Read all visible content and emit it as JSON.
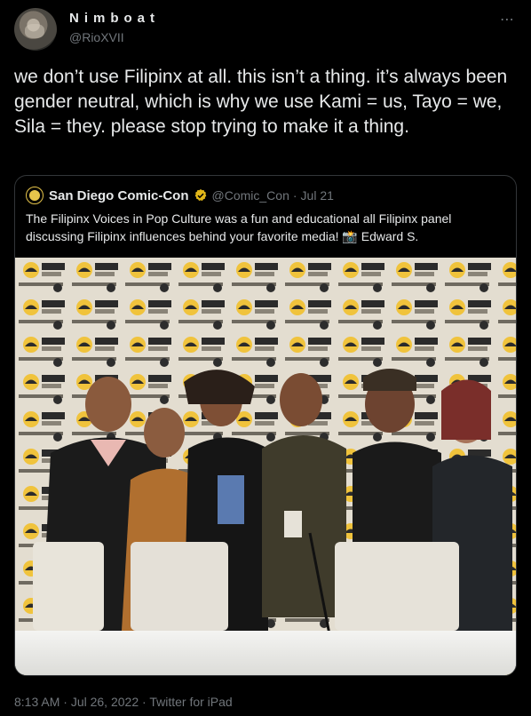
{
  "author": {
    "display_name": "Nimboat",
    "handle": "@RioXVII",
    "more_icon": "⋯"
  },
  "tweet": {
    "text": "we don’t use Filipinx at all. this isn’t a thing. it’s always been gender neutral, which is why we use Kami = us, Tayo = we, Sila = they. please stop trying to make it a thing."
  },
  "quote": {
    "display_name": "San Diego Comic-Con",
    "handle": "@Comic_Con",
    "separator": "·",
    "date": "Jul 21",
    "text": "The Filipinx Voices in Pop Culture was a fun and educational all Filipinx panel discussing Filipinx influences behind your favorite media! 📸 Edward S.",
    "photo_backdrop_text": "COMIC CON"
  },
  "meta": {
    "time": "8:13 AM",
    "separator1": "·",
    "date": "Jul 26, 2022",
    "separator2": "·",
    "source": "Twitter for iPad"
  },
  "colors": {
    "background": "#000000",
    "text_primary": "#e7e9ea",
    "text_secondary": "#71767b",
    "border": "#333639",
    "verified_gold": "#e2b719"
  }
}
